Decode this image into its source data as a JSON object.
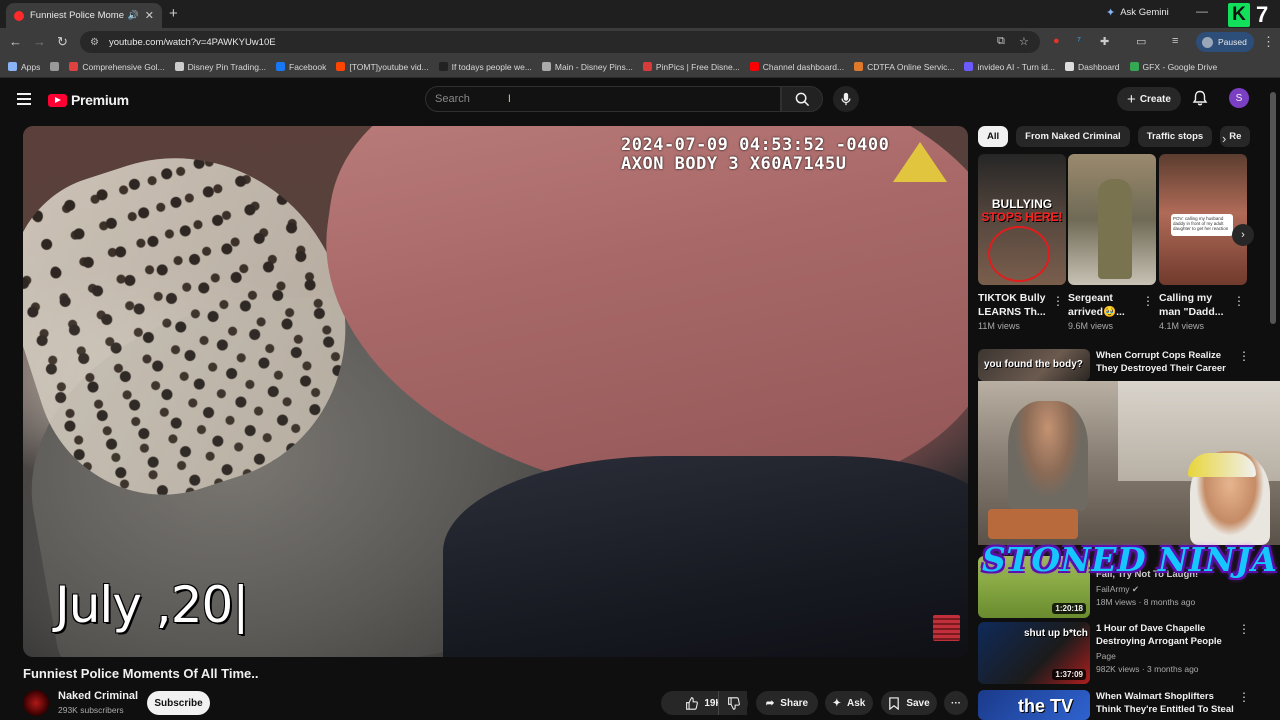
{
  "browser": {
    "tab_title": "Funniest Police Moments O",
    "speaker_glyph": "🔊",
    "close_glyph": "✕",
    "new_tab_glyph": "+",
    "ask_gemini": "Ask Gemini",
    "min_glyph": "—",
    "profile_status": "Paused",
    "url": "youtube.com/watch?v=4PAWKYUw10E",
    "k7_k": "K",
    "k7_num": "7",
    "bookmarks": [
      {
        "label": "Apps",
        "color": "#8ab4f8"
      },
      {
        "label": "",
        "color": "#999999"
      },
      {
        "label": "Comprehensive Gol...",
        "color": "#e04040"
      },
      {
        "label": "Disney Pin Trading...",
        "color": "#cccccc"
      },
      {
        "label": "Facebook",
        "color": "#1877f2"
      },
      {
        "label": "[TOMT]youtube vid...",
        "color": "#ff4500"
      },
      {
        "label": "If todays people we...",
        "color": "#222222"
      },
      {
        "label": "Main - Disney Pins...",
        "color": "#aaaaaa"
      },
      {
        "label": "PinPics | Free Disne...",
        "color": "#d93a3a"
      },
      {
        "label": "Channel dashboard...",
        "color": "#ff0000"
      },
      {
        "label": "CDTFA Online Servic...",
        "color": "#e07a2a"
      },
      {
        "label": "invideo AI - Turn id...",
        "color": "#6b5bff"
      },
      {
        "label": "Dashboard",
        "color": "#dddddd"
      },
      {
        "label": "GFX - Google Drive",
        "color": "#34a853"
      }
    ]
  },
  "youtube": {
    "brand": "Premium",
    "search_placeholder": "Search",
    "create_label": "Create",
    "avatar_letter": "S"
  },
  "player": {
    "timestamp_line1": "2024-07-09 04:53:52 -0400",
    "timestamp_line2": "AXON BODY 3 X60A7145U",
    "date_overlay": "July ,20|"
  },
  "video": {
    "title": "Funniest Police Moments Of All Time..",
    "channel": "Naked Criminal",
    "subscribers": "293K subscribers",
    "subscribe_label": "Subscribe",
    "likes": "19K",
    "share_label": "Share",
    "ask_label": "Ask",
    "save_label": "Save",
    "more_glyph": "···"
  },
  "sidebar": {
    "chips": [
      {
        "label": "All",
        "active": true
      },
      {
        "label": "From Naked Criminal",
        "active": false
      },
      {
        "label": "Traffic stops",
        "active": false
      },
      {
        "label": "Re",
        "active": false
      }
    ],
    "shorts": [
      {
        "title": "TIKTOK Bully LEARNS Th...",
        "views": "11M views",
        "thumb_line1": "BULLYING",
        "thumb_line2": "STOPS HERE!"
      },
      {
        "title": "Sergeant arrived🥹...",
        "views": "9.6M views"
      },
      {
        "title": "Calling my man \"Dadd...",
        "views": "4.1M views",
        "thumb_note": "POV: calling my husband daddy in front of my adult daughter to get her reaction"
      }
    ],
    "recommendations": [
      {
        "title": "When Corrupt Cops Realize They Destroyed Their Career",
        "thumb_text": "you found the body?"
      },
      {
        "title": "Fail, Try Not To Laugh!",
        "channel": "FailArmy",
        "meta": "18M views · 8 months ago",
        "duration": "1:20:18"
      },
      {
        "title": "1 Hour of Dave Chapelle Destroying Arrogant People",
        "channel": "Page",
        "meta": "982K views · 3 months ago",
        "duration": "1:37:09",
        "thumb_text": "shut up b*tch"
      },
      {
        "title": "When Walmart Shoplifters Think They're Entitled To Steal",
        "thumb_text": "the TV"
      }
    ],
    "overlay_text": "STONED NINJA"
  }
}
